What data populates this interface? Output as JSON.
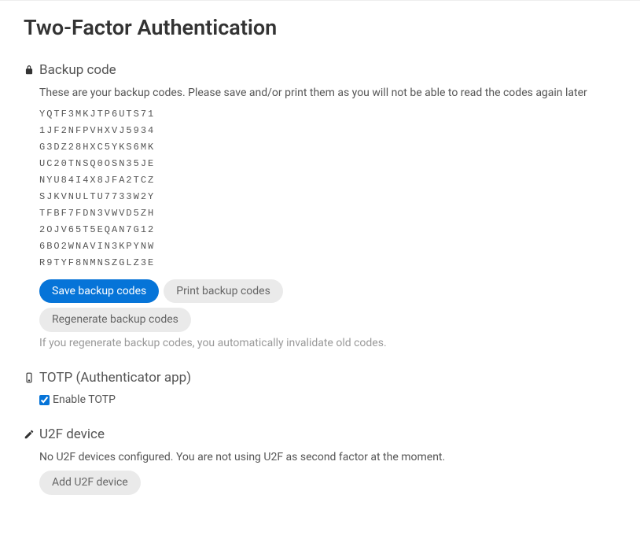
{
  "page": {
    "title": "Two-Factor Authentication"
  },
  "backup": {
    "heading": "Backup code",
    "description": "These are your backup codes. Please save and/or print them as you will not be able to read the codes again later",
    "codes": [
      "YQTF3MKJTP6UTS71",
      "1JF2NFPVHXVJ5934",
      "G3DZ28HXC5YKS6MK",
      "UC20TNSQ0OSN35JE",
      "NYU84I4X8JFA2TCZ",
      "SJKVNULTU7733W2Y",
      "TFBF7FDN3VWVD5ZH",
      "2OJV65T5EQAN7G12",
      "6BO2WNAVIN3KPYNW",
      "R9TYF8NMNSZGLZ3E"
    ],
    "save_label": "Save backup codes",
    "print_label": "Print backup codes",
    "regenerate_label": "Regenerate backup codes",
    "regenerate_hint": "If you regenerate backup codes, you automatically invalidate old codes."
  },
  "totp": {
    "heading": "TOTP (Authenticator app)",
    "enable_label": "Enable TOTP",
    "enabled": true
  },
  "u2f": {
    "heading": "U2F device",
    "description": "No U2F devices configured. You are not using U2F as second factor at the moment.",
    "add_label": "Add U2F device"
  }
}
